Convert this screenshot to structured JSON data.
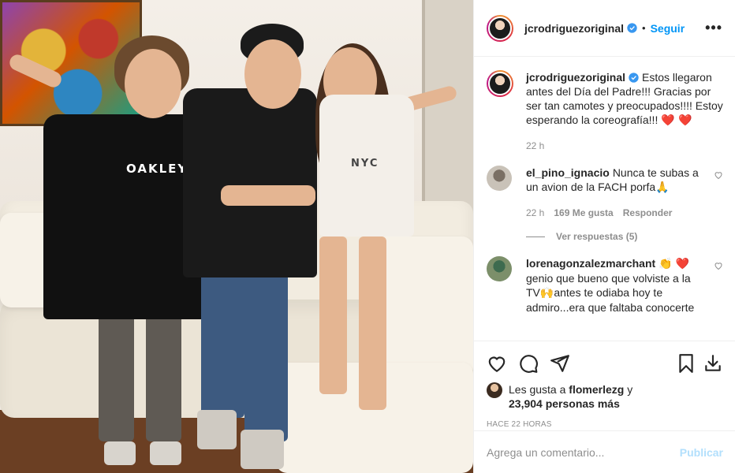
{
  "post": {
    "username": "jcrodriguezoriginal",
    "follow_label": "Seguir",
    "separator": "•",
    "more_label": "•••"
  },
  "caption": {
    "username": "jcrodriguezoriginal",
    "text": "Estos llegaron antes del Día del Padre!!! Gracias por ser tan camotes y preocupados!!!! Estoy esperando la coreografía!!!",
    "emoji": "❤️ ❤️",
    "time": "22 h"
  },
  "comments": [
    {
      "username": "el_pino_ignacio",
      "text": "Nunca te subas a un avion de la FACH porfa",
      "emoji": "🙏",
      "time": "22 h",
      "likes": "169 Me gusta",
      "reply_label": "Responder",
      "view_replies": "Ver respuestas (5)"
    },
    {
      "username": "lorenagonzalezmarchant",
      "text_emoji_1": "👏",
      "text_emoji_2": "❤️",
      "text_part1": "genio que bueno que volviste a la TV",
      "text_emoji_3": "🙌",
      "text_part2": "antes te odiaba hoy te admiro...era que faltaba conocerte"
    }
  ],
  "likes": {
    "prefix": "Les gusta a",
    "user": "flomerlezg",
    "connector": "y",
    "count": "23,904 personas más"
  },
  "time_ago": "HACE 22 HORAS",
  "add_comment": {
    "placeholder": "Agrega un comentario...",
    "publish_label": "Publicar"
  },
  "photo": {
    "shirt_logo": "OAKLEY",
    "shirt_text": "NYC"
  },
  "colors": {
    "accent": "#0095f6",
    "publish_disabled": "#b2dffc",
    "muted": "#8e8e8e",
    "like_red": "#ed4956"
  }
}
